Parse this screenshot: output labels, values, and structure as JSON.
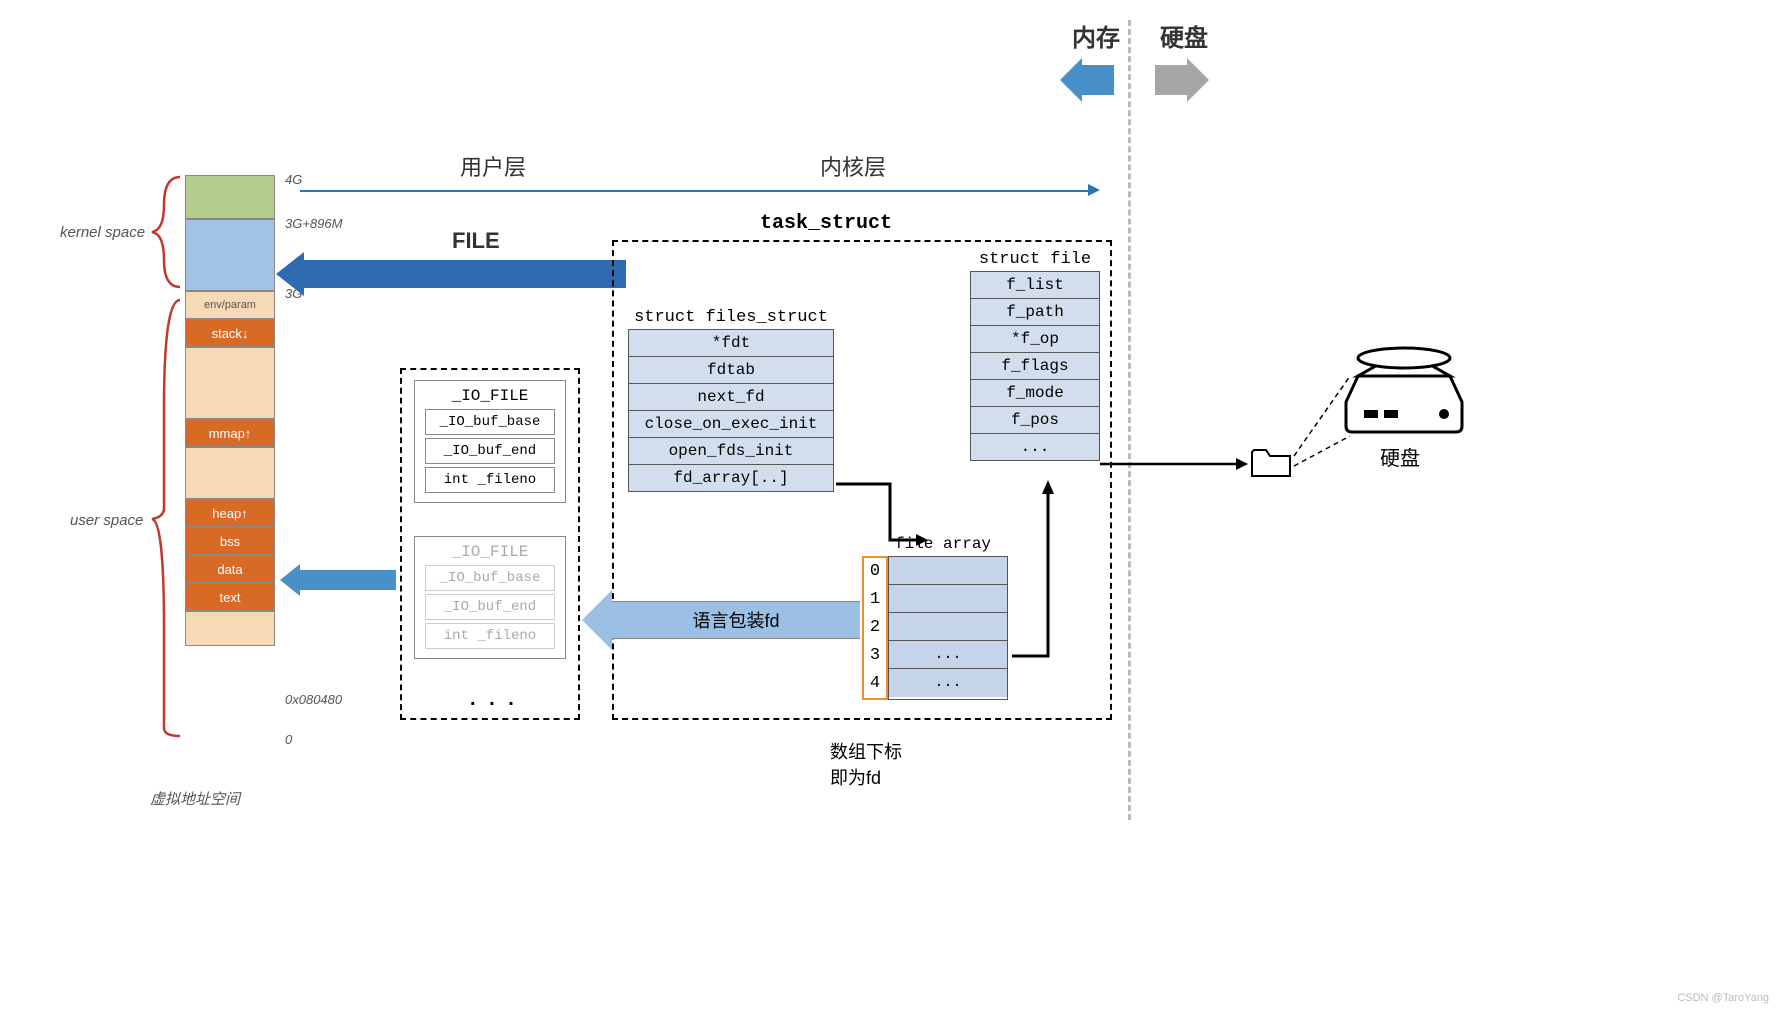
{
  "top": {
    "memory_label": "内存",
    "disk_label": "硬盘",
    "user_layer": "用户层",
    "kernel_layer": "内核层",
    "task_struct": "task_struct"
  },
  "memory": {
    "kernel_space": "kernel space",
    "user_space": "user space",
    "caption": "虚拟地址空间",
    "marks": {
      "m4g": "4G",
      "m3g896": "3G+896M",
      "m3g": "3G",
      "addr": "0x080480",
      "zero": "0"
    },
    "cells": {
      "env": "env/param",
      "stack": "stack↓",
      "mmap": "mmap↑",
      "heap": "heap↑",
      "bss": "bss",
      "data": "data",
      "text": "text"
    }
  },
  "arrows": {
    "file": "FILE",
    "lang_wrap": "语言包装fd"
  },
  "io_file": {
    "title": "_IO_FILE",
    "rows": [
      "_IO_buf_base",
      "_IO_buf_end",
      "int _fileno"
    ],
    "ellipsis": ". . ."
  },
  "files_struct": {
    "title": "struct files_struct",
    "rows": [
      "*fdt",
      "fdtab",
      "next_fd",
      "close_on_exec_init",
      "open_fds_init",
      "fd_array[..]"
    ]
  },
  "struct_file": {
    "title": "struct file",
    "rows": [
      "f_list",
      "f_path",
      "*f_op",
      "f_flags",
      "f_mode",
      "f_pos",
      "..."
    ]
  },
  "file_array": {
    "title": "file array",
    "idx": [
      "0",
      "1",
      "2",
      "3",
      "4"
    ],
    "cells": [
      "",
      "",
      "",
      "...",
      "..."
    ],
    "note1": "数组下标",
    "note2": "即为fd"
  },
  "disk": {
    "label": "硬盘"
  },
  "watermark": "CSDN @TaroYang"
}
